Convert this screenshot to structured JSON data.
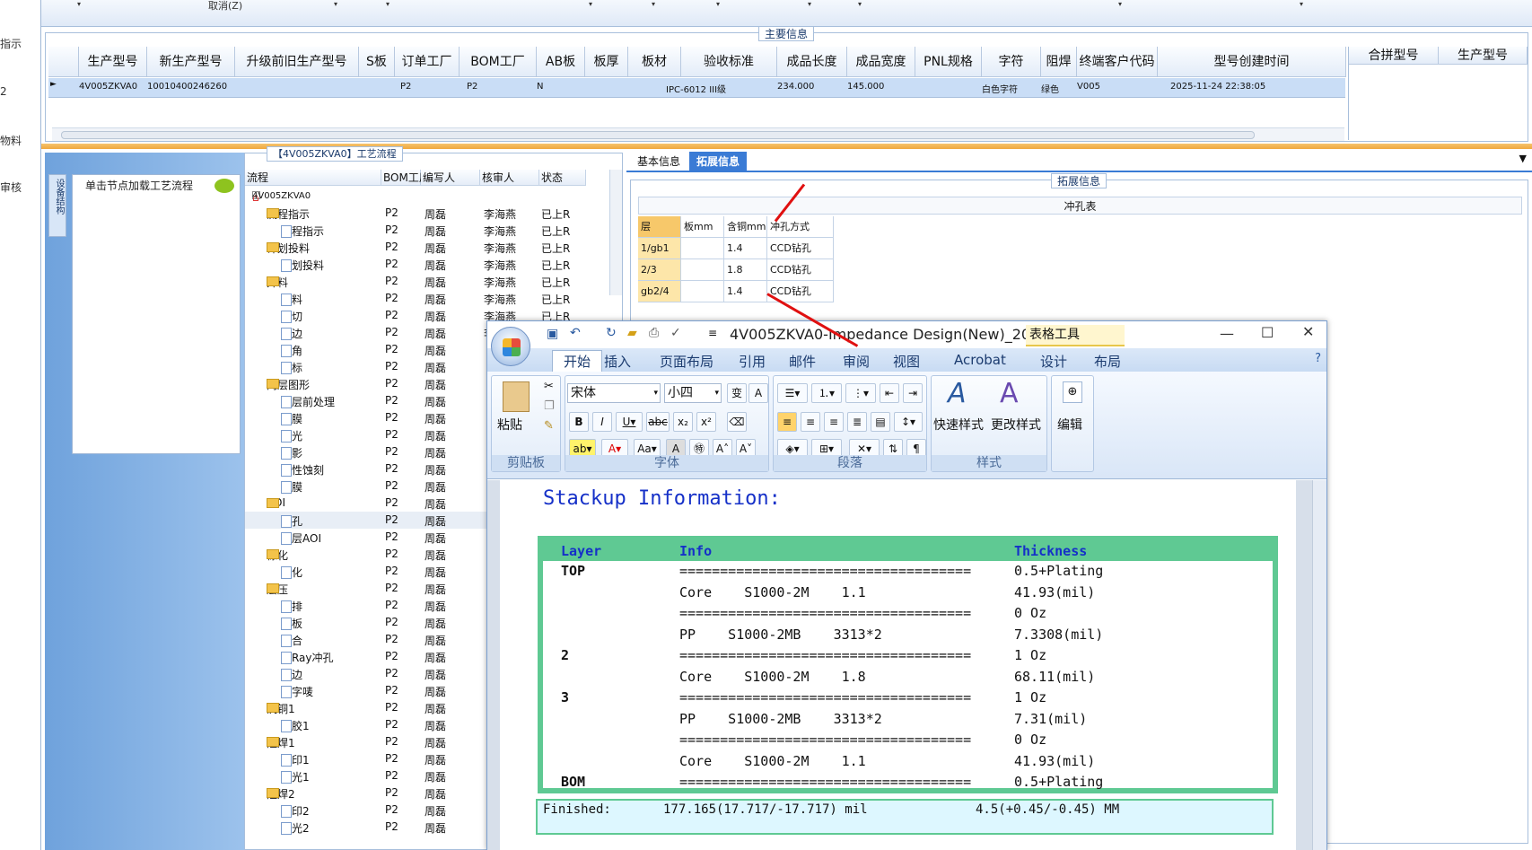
{
  "left_strip": [
    "指示",
    "2",
    "物料",
    "审核"
  ],
  "topbar": {
    "cancel": "取消(Z)"
  },
  "main_info": {
    "legend": "主要信息",
    "columns": [
      "生产型号",
      "新生产型号",
      "升级前旧生产型号",
      "S板",
      "订单工厂",
      "BOM工厂",
      "AB板",
      "板厚",
      "板材",
      "验收标准",
      "成品长度",
      "成品宽度",
      "PNL规格",
      "字符",
      "阻焊",
      "终端客户代码",
      "型号创建时间"
    ],
    "row": [
      "4V005ZKVA0",
      "10010400246260",
      "",
      "",
      "P2",
      "P2",
      "N",
      "",
      "",
      "IPC-6012 III级",
      "234.000",
      "145.000",
      "",
      "白色字符",
      "绿色",
      "V005",
      "2025-11-24 22:38:05"
    ],
    "right_columns": [
      "合拼型号",
      "生产型号"
    ]
  },
  "left_panel": {
    "vtab": "设备结构",
    "node_hint": "单击节点加载工艺流程"
  },
  "flow": {
    "legend": "【4V005ZKVA0】工艺流程",
    "columns": [
      "流程",
      "BOM工厂",
      "编写人",
      "核审人",
      "状态"
    ],
    "root": "4V005ZKVA0",
    "rows": [
      {
        "name": "流程指示",
        "folder": true,
        "factory": "P2",
        "writer": "周磊",
        "reviewer": "李海燕",
        "status": "已上R"
      },
      {
        "name": "流程指示",
        "folder": false,
        "factory": "P2",
        "writer": "周磊",
        "reviewer": "李海燕",
        "status": "已上R"
      },
      {
        "name": "计划投料",
        "folder": true,
        "factory": "P2",
        "writer": "周磊",
        "reviewer": "李海燕",
        "status": "已上R"
      },
      {
        "name": "计划投料",
        "folder": false,
        "factory": "P2",
        "writer": "周磊",
        "reviewer": "李海燕",
        "status": "已上R"
      },
      {
        "name": "开料",
        "folder": true,
        "factory": "P2",
        "writer": "周磊",
        "reviewer": "李海燕",
        "status": "已上R"
      },
      {
        "name": "开料",
        "folder": false,
        "factory": "P2",
        "writer": "周磊",
        "reviewer": "李海燕",
        "status": "已上R"
      },
      {
        "name": "裁切",
        "folder": false,
        "factory": "P2",
        "writer": "周磊",
        "reviewer": "李海燕",
        "status": "已上R"
      },
      {
        "name": "磨边",
        "folder": false,
        "factory": "P2",
        "writer": "周磊",
        "reviewer": "李海燕",
        "status": ""
      },
      {
        "name": "圆角",
        "folder": false,
        "factory": "P2",
        "writer": "周磊",
        "reviewer": "",
        "status": ""
      },
      {
        "name": "打标",
        "folder": false,
        "factory": "P2",
        "writer": "周磊",
        "reviewer": "",
        "status": ""
      },
      {
        "name": "内层图形",
        "folder": true,
        "factory": "P2",
        "writer": "周磊",
        "reviewer": "",
        "status": ""
      },
      {
        "name": "内层前处理",
        "folder": false,
        "factory": "P2",
        "writer": "周磊",
        "reviewer": "",
        "status": ""
      },
      {
        "name": "贴膜",
        "folder": false,
        "factory": "P2",
        "writer": "周磊",
        "reviewer": "",
        "status": ""
      },
      {
        "name": "曝光",
        "folder": false,
        "factory": "P2",
        "writer": "周磊",
        "reviewer": "",
        "status": ""
      },
      {
        "name": "显影",
        "folder": false,
        "factory": "P2",
        "writer": "周磊",
        "reviewer": "",
        "status": ""
      },
      {
        "name": "酸性蚀刻",
        "folder": false,
        "factory": "P2",
        "writer": "周磊",
        "reviewer": "",
        "status": ""
      },
      {
        "name": "退膜",
        "folder": false,
        "factory": "P2",
        "writer": "周磊",
        "reviewer": "",
        "status": ""
      },
      {
        "name": "AOI",
        "folder": true,
        "factory": "P2",
        "writer": "周磊",
        "reviewer": "",
        "status": ""
      },
      {
        "name": "冲孔",
        "folder": false,
        "factory": "P2",
        "writer": "周磊",
        "reviewer": "",
        "status": ""
      },
      {
        "name": "内层AOI",
        "folder": false,
        "factory": "P2",
        "writer": "周磊",
        "reviewer": "",
        "status": ""
      },
      {
        "name": "棕化",
        "folder": true,
        "factory": "P2",
        "writer": "周磊",
        "reviewer": "",
        "status": ""
      },
      {
        "name": "棕化",
        "folder": false,
        "factory": "P2",
        "writer": "周磊",
        "reviewer": "",
        "status": ""
      },
      {
        "name": "层压",
        "folder": true,
        "factory": "P2",
        "writer": "周磊",
        "reviewer": "",
        "status": ""
      },
      {
        "name": "预排",
        "folder": false,
        "factory": "P2",
        "writer": "周磊",
        "reviewer": "",
        "status": ""
      },
      {
        "name": "排板",
        "folder": false,
        "factory": "P2",
        "writer": "周磊",
        "reviewer": "",
        "status": ""
      },
      {
        "name": "压合",
        "folder": false,
        "factory": "P2",
        "writer": "周磊",
        "reviewer": "",
        "status": ""
      },
      {
        "name": "X-Ray冲孔",
        "folder": false,
        "factory": "P2",
        "writer": "周磊",
        "reviewer": "",
        "status": ""
      },
      {
        "name": "铣边",
        "folder": false,
        "factory": "P2",
        "writer": "周磊",
        "reviewer": "",
        "status": ""
      },
      {
        "name": "打字唛",
        "folder": false,
        "factory": "P2",
        "writer": "周磊",
        "reviewer": "",
        "status": ""
      },
      {
        "name": "沉铜1",
        "folder": true,
        "factory": "P2",
        "writer": "周磊",
        "reviewer": "",
        "status": ""
      },
      {
        "name": "除胶1",
        "folder": false,
        "factory": "P2",
        "writer": "周磊",
        "reviewer": "",
        "status": ""
      },
      {
        "name": "阻焊1",
        "folder": true,
        "factory": "P2",
        "writer": "周磊",
        "reviewer": "",
        "status": ""
      },
      {
        "name": "丝印1",
        "folder": false,
        "factory": "P2",
        "writer": "周磊",
        "reviewer": "",
        "status": ""
      },
      {
        "name": "曝光1",
        "folder": false,
        "factory": "P2",
        "writer": "周磊",
        "reviewer": "",
        "status": ""
      },
      {
        "name": "阻焊2",
        "folder": true,
        "factory": "P2",
        "writer": "周磊",
        "reviewer": "",
        "status": ""
      },
      {
        "name": "丝印2",
        "folder": false,
        "factory": "P2",
        "writer": "周磊",
        "reviewer": "",
        "status": ""
      },
      {
        "name": "曝光2",
        "folder": false,
        "factory": "P2",
        "writer": "周磊",
        "reviewer": "",
        "status": ""
      }
    ]
  },
  "tabs": {
    "basic": "基本信息",
    "ext": "拓展信息"
  },
  "ext": {
    "legend": "拓展信息",
    "punch_title": "冲孔表",
    "columns": [
      "层",
      "板mm",
      "含铜mm",
      "冲孔方式"
    ],
    "rows": [
      [
        "1/gb1",
        "",
        "1.4",
        "CCD钻孔"
      ],
      [
        "2/3",
        "",
        "1.8",
        "CCD钻孔"
      ],
      [
        "gb2/4",
        "",
        "1.4",
        "CCD钻孔"
      ]
    ]
  },
  "word": {
    "title": "4V005ZKVA0-Impedance Design(New)_20...",
    "table_tools": "表格工具",
    "ribbon_tabs": [
      "开始",
      "插入",
      "页面布局",
      "引用",
      "邮件",
      "审阅",
      "视图",
      "Acrobat",
      "设计",
      "布局"
    ],
    "font": "宋体",
    "size": "小四",
    "groups": {
      "clipboard": "剪贴板",
      "font": "字体",
      "paragraph": "段落",
      "styles": "样式"
    },
    "paste": "粘贴",
    "quick_style": "快速样式",
    "change_style": "更改样式",
    "edit": "编辑",
    "doc_title": "Stackup Information:",
    "stack_header": {
      "layer": "Layer",
      "info": "Info",
      "thickness": "Thickness"
    },
    "stack_rows": [
      {
        "layer": "TOP",
        "info": "====================================",
        "thickness": "0.5+Plating"
      },
      {
        "layer": "",
        "info": "Core    S1000-2M    1.1",
        "thickness": "41.93(mil)"
      },
      {
        "layer": "",
        "info": "====================================",
        "thickness": "0 Oz"
      },
      {
        "layer": "",
        "info": "PP    S1000-2MB    3313*2",
        "thickness": "7.3308(mil)"
      },
      {
        "layer": "2",
        "info": "====================================",
        "thickness": "1 Oz"
      },
      {
        "layer": "",
        "info": "Core    S1000-2M    1.8",
        "thickness": "68.11(mil)"
      },
      {
        "layer": "3",
        "info": "====================================",
        "thickness": "1 Oz"
      },
      {
        "layer": "",
        "info": "PP    S1000-2MB    3313*2",
        "thickness": "7.31(mil)"
      },
      {
        "layer": "",
        "info": "====================================",
        "thickness": "0 Oz"
      },
      {
        "layer": "",
        "info": "Core    S1000-2M    1.1",
        "thickness": "41.93(mil)"
      },
      {
        "layer": "BOM",
        "info": "====================================",
        "thickness": "0.5+Plating"
      }
    ],
    "finished": {
      "label": "Finished:",
      "mil": "177.165(17.717/-17.717) mil",
      "mm": "4.5(+0.45/-0.45) MM"
    }
  }
}
